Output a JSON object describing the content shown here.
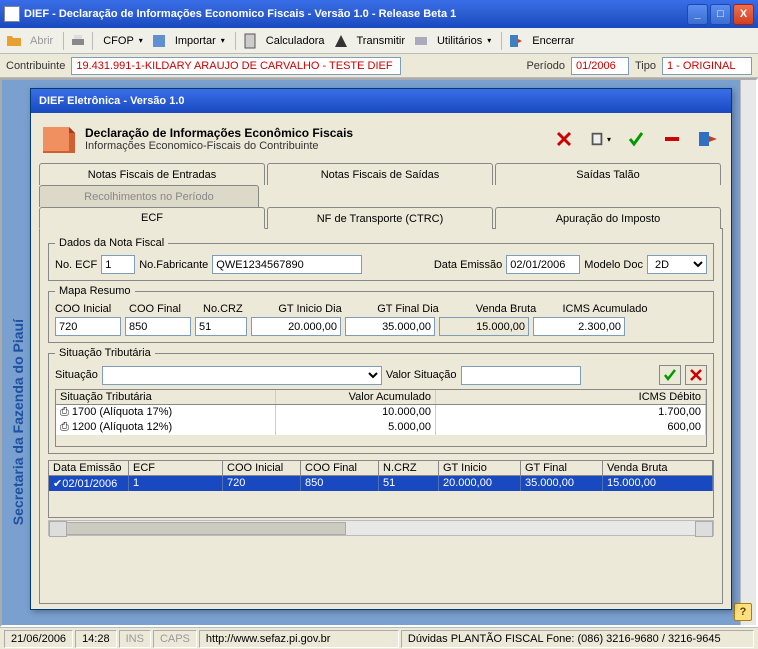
{
  "window": {
    "title": "DIEF - Declaração de Informações Economico Fiscais - Versão 1.0 - Release Beta 1"
  },
  "toolbar": {
    "abrir": "Abrir",
    "cfop": "CFOP",
    "importar": "Importar",
    "calculadora": "Calculadora",
    "transmitir": "Transmitir",
    "utilitarios": "Utilitários",
    "encerrar": "Encerrar"
  },
  "infobar": {
    "contribuinte_label": "Contribuinte",
    "contribuinte": "19.431.991-1-KILDARY ARAUJO DE CARVALHO - TESTE DIEF",
    "periodo_label": "Período",
    "periodo": "01/2006",
    "tipo_label": "Tipo",
    "tipo": "1 - ORIGINAL"
  },
  "sidebar_text": "Secretaria da Fazenda do Piauí",
  "mdichild": {
    "title": "DIEF Eletrônica - Versão 1.0",
    "hdr1": "Declaração de Informações Econômico Fiscais",
    "hdr2": "Informações Economico-Fiscais do Contribuinte"
  },
  "tabs_top": {
    "entradas": "Notas Fiscais de Entradas",
    "saidas": "Notas Fiscais de Saídas",
    "talao": "Saídas Talão",
    "recolhimentos": "Recolhimentos no Período"
  },
  "tabs_sub": {
    "ecf": "ECF",
    "ctrc": "NF de Transporte (CTRC)",
    "apuracao": "Apuração do Imposto"
  },
  "dados_nf": {
    "legend": "Dados da Nota Fiscal",
    "no_ecf_label": "No. ECF",
    "no_ecf": "1",
    "no_fabricante_label": "No.Fabricante",
    "no_fabricante": "QWE1234567890",
    "data_emissao_label": "Data Emissão",
    "data_emissao": "02/01/2006",
    "modelo_doc_label": "Modelo Doc",
    "modelo_doc": "2D"
  },
  "mapa": {
    "legend": "Mapa Resumo",
    "coo_inicial_label": "COO Inicial",
    "coo_inicial": "720",
    "coo_final_label": "COO Final",
    "coo_final": "850",
    "no_crz_label": "No.CRZ",
    "no_crz": "51",
    "gt_inicio_label": "GT Inicio Dia",
    "gt_inicio": "20.000,00",
    "gt_final_label": "GT Final Dia",
    "gt_final": "35.000,00",
    "venda_bruta_label": "Venda Bruta",
    "venda_bruta": "15.000,00",
    "icms_acum_label": "ICMS Acumulado",
    "icms_acum": "2.300,00"
  },
  "sit_trib": {
    "legend": "Situação Tributária",
    "situacao_label": "Situação",
    "valor_situacao_label": "Valor Situação",
    "col1": "Situação Tributária",
    "col2": "Valor Acumulado",
    "col3": "ICMS Débito",
    "rows": [
      {
        "sit": "1700 (Alíquota 17%)",
        "val": "10.000,00",
        "icms": "1.700,00"
      },
      {
        "sit": "1200 (Alíquota 12%)",
        "val": "5.000,00",
        "icms": "600,00"
      }
    ]
  },
  "bigtable": {
    "headers": {
      "c0": "Data Emissão",
      "c1": "ECF",
      "c2": "COO Inicial",
      "c3": "COO Final",
      "c4": "N.CRZ",
      "c5": "GT Inicio",
      "c6": "GT Final",
      "c7": "Venda Bruta"
    },
    "row": {
      "c0": "02/01/2006",
      "c1": "1",
      "c2": "720",
      "c3": "850",
      "c4": "51",
      "c5": "20.000,00",
      "c6": "35.000,00",
      "c7": "15.000,00"
    }
  },
  "statusbar": {
    "date": "21/06/2006",
    "time": "14:28",
    "ins": "INS",
    "caps": "CAPS",
    "url": "http://www.sefaz.pi.gov.br",
    "duvidas": "Dúvidas PLANTÃO FISCAL Fone: (086) 3216-9680 / 3216-9645"
  }
}
